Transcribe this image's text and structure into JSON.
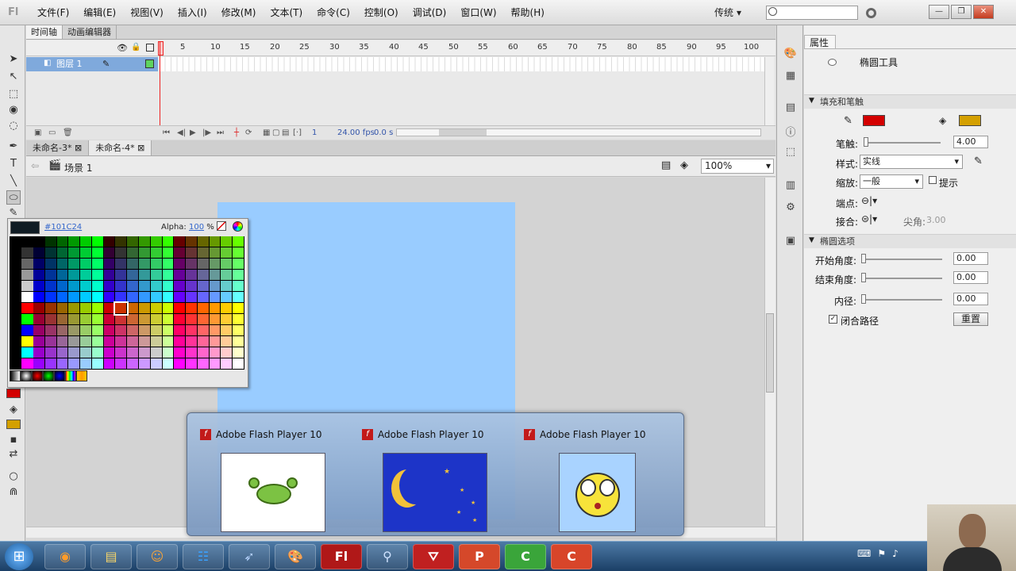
{
  "app": {
    "logo": "Fl",
    "workspace": "传统",
    "workspace_arrow": "▾"
  },
  "menu": [
    "文件(F)",
    "编辑(E)",
    "视图(V)",
    "插入(I)",
    "修改(M)",
    "文本(T)",
    "命令(C)",
    "控制(O)",
    "调试(D)",
    "窗口(W)",
    "帮助(H)"
  ],
  "window_buttons": {
    "minimize": "—",
    "restore": "❐",
    "close": "✕"
  },
  "timeline": {
    "tabs": [
      "时间轴",
      "动画编辑器"
    ],
    "frame_numbers": [
      "1",
      "5",
      "10",
      "15",
      "20",
      "25",
      "30",
      "35",
      "40",
      "45",
      "50",
      "55",
      "60",
      "65",
      "70",
      "75",
      "80",
      "85",
      "90",
      "95",
      "100"
    ],
    "layer_name": "图层 1",
    "current_frame": "1",
    "fps": "24.00 fps",
    "time": "0.0 s"
  },
  "documents": {
    "tabs": [
      "未命名-3*",
      "未命名-4*"
    ],
    "scene": "场景 1",
    "zoom": "100%"
  },
  "color_picker": {
    "hex": "#101C24",
    "alpha_label": "Alpha:",
    "alpha_value": "100",
    "alpha_unit": "%",
    "selected_color": "#101C24"
  },
  "properties": {
    "tab": "属性",
    "tool_name": "椭圆工具",
    "section_fill": "填充和笔触",
    "stroke_color": "#d40000",
    "fill_color": "#d4a000",
    "stroke_label": "笔触:",
    "stroke_value": "4.00",
    "style_label": "样式:",
    "style_value": "实线",
    "scale_label": "缩放:",
    "scale_value": "一般",
    "hint_label": "提示",
    "cap_label": "端点:",
    "join_label": "接合:",
    "miter_label": "尖角:",
    "miter_value": "3.00",
    "section_oval": "椭圆选项",
    "start_angle_label": "开始角度:",
    "start_angle_value": "0.00",
    "end_angle_label": "结束角度:",
    "end_angle_value": "0.00",
    "inner_radius_label": "内径:",
    "inner_radius_value": "0.00",
    "close_path_label": "闭合路径",
    "reset_label": "重置"
  },
  "taskbar_thumbnails": [
    {
      "title": "Adobe Flash Player 10",
      "icon": "crab"
    },
    {
      "title": "Adobe Flash Player 10",
      "icon": "moon-night"
    },
    {
      "title": "Adobe Flash Player 10",
      "icon": "surprised-face"
    }
  ],
  "taskbar_apps": [
    "firefox-icon",
    "explorer-icon",
    "scratch-icon",
    "app-grid-icon",
    "bird-icon",
    "paint-icon",
    "flash-icon",
    "network-icon",
    "acrobat-icon",
    "powerpoint-icon",
    "camtasia-recorder-icon",
    "camtasia-studio-icon"
  ],
  "taskbar_labels": {
    "flash": "Fl",
    "powerpoint": "P",
    "camtasia1": "C",
    "camtasia2": "C"
  }
}
